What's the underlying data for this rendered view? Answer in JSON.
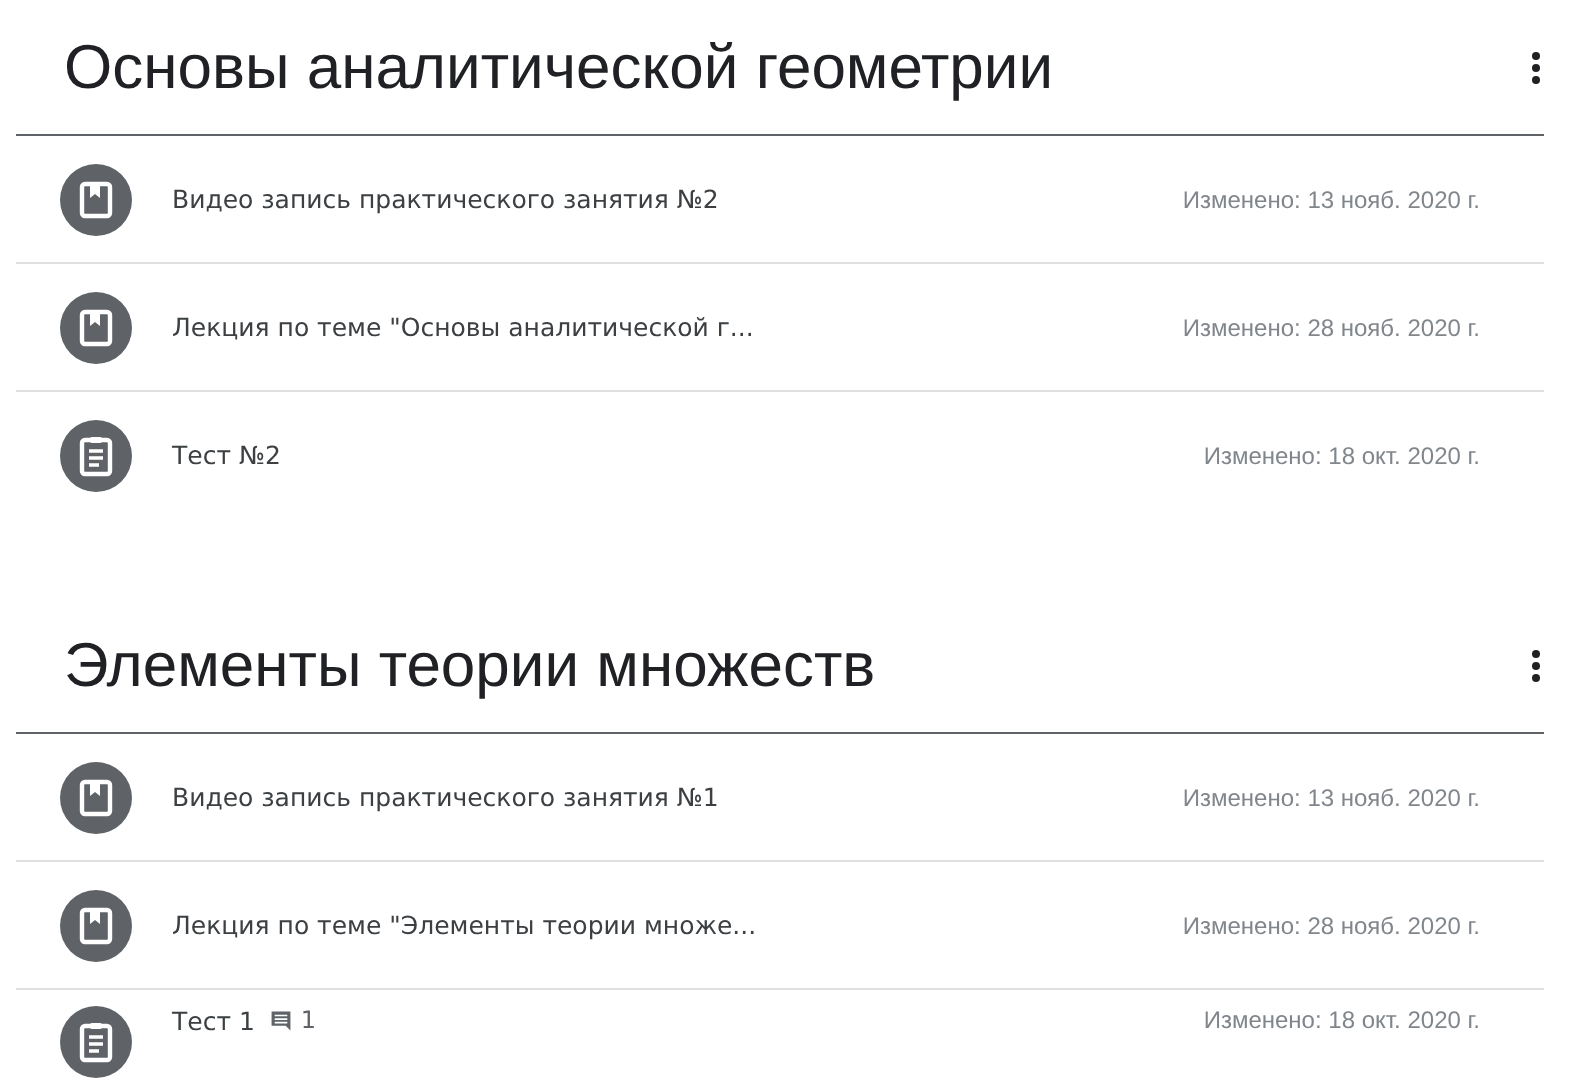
{
  "topics": [
    {
      "title": "Основы аналитической геометрии",
      "items": [
        {
          "kind": "material",
          "title": "Видео запись практического занятия №2",
          "date": "Изменено: 13 нояб. 2020 г."
        },
        {
          "kind": "material",
          "title": "Лекция по теме \"Основы аналитической г...",
          "date": "Изменено: 28 нояб. 2020 г."
        },
        {
          "kind": "assignment",
          "title": "Тест №2",
          "date": "Изменено: 18 окт. 2020 г."
        }
      ]
    },
    {
      "title": "Элементы теории множеств",
      "items": [
        {
          "kind": "material",
          "title": "Видео запись практического занятия №1",
          "date": "Изменено: 13 нояб. 2020 г."
        },
        {
          "kind": "material",
          "title": "Лекция по теме \"Элементы теории множе...",
          "date": "Изменено: 28 нояб. 2020 г."
        },
        {
          "kind": "assignment",
          "title": "Тест 1",
          "comments": "1",
          "date": "Изменено: 18 окт. 2020 г."
        }
      ]
    }
  ]
}
